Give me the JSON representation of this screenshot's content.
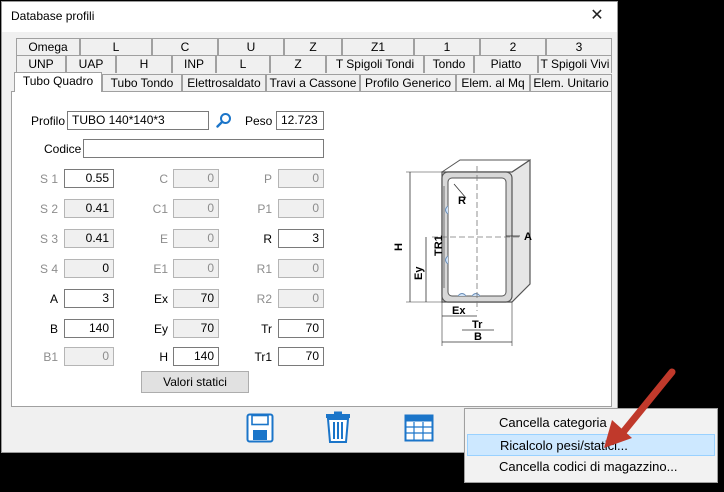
{
  "window": {
    "title": "Database profili",
    "close_glyph": "✕"
  },
  "tabs": {
    "row1": [
      "Omega",
      "L",
      "C",
      "U",
      "Z",
      "Z1",
      "1",
      "2",
      "3"
    ],
    "row2": [
      "UNP",
      "UAP",
      "H",
      "INP",
      "L",
      "Z",
      "T Spigoli Tondi",
      "Tondo",
      "Piatto",
      "T Spigoli Vivi"
    ],
    "row3": [
      "Tubo Quadro",
      "Tubo Tondo",
      "Elettrosaldato",
      "Travi a Cassone",
      "Profilo Generico",
      "Elem. al Mq",
      "Elem. Unitario"
    ],
    "active": "Tubo Quadro"
  },
  "form": {
    "profilo_label": "Profilo",
    "profilo_value": "TUBO 140*140*3",
    "peso_label": "Peso",
    "peso_value": "12.723",
    "codice_label": "Codice",
    "codice_value": "",
    "col1": [
      {
        "label": "S 1",
        "value": "0.55"
      },
      {
        "label": "S 2",
        "value": "0.41"
      },
      {
        "label": "S 3",
        "value": "0.41"
      },
      {
        "label": "S 4",
        "value": "0"
      },
      {
        "label": "A",
        "value": "3"
      },
      {
        "label": "B",
        "value": "140"
      },
      {
        "label": "B1",
        "value": "0"
      }
    ],
    "col2": [
      {
        "label": "C",
        "value": "0"
      },
      {
        "label": "C1",
        "value": "0"
      },
      {
        "label": "E",
        "value": "0"
      },
      {
        "label": "E1",
        "value": "0"
      },
      {
        "label": "Ex",
        "value": "70"
      },
      {
        "label": "Ey",
        "value": "70"
      },
      {
        "label": "H",
        "value": "140"
      }
    ],
    "col3": [
      {
        "label": "P",
        "value": "0"
      },
      {
        "label": "P1",
        "value": "0"
      },
      {
        "label": "R",
        "value": "3"
      },
      {
        "label": "R1",
        "value": "0"
      },
      {
        "label": "R2",
        "value": "0"
      },
      {
        "label": "Tr",
        "value": "70"
      },
      {
        "label": "Tr1",
        "value": "70"
      }
    ],
    "valori_button": "Valori statici"
  },
  "diagram": {
    "labels": {
      "R": "R",
      "A": "A",
      "H": "H",
      "TR1": "TR1",
      "Ey": "Ey",
      "Ex": "Ex",
      "Tr": "Tr",
      "B": "B"
    }
  },
  "context_menu": {
    "items": [
      "Cancella categoria",
      "Ricalcolo pesi/statici...",
      "Cancella codici di magazzino..."
    ],
    "highlighted": 1
  },
  "colors": {
    "accent_arrow": "#c0392b",
    "menu_highlight": "#cde8ff",
    "toolbar_icon": "#1b75c9"
  }
}
